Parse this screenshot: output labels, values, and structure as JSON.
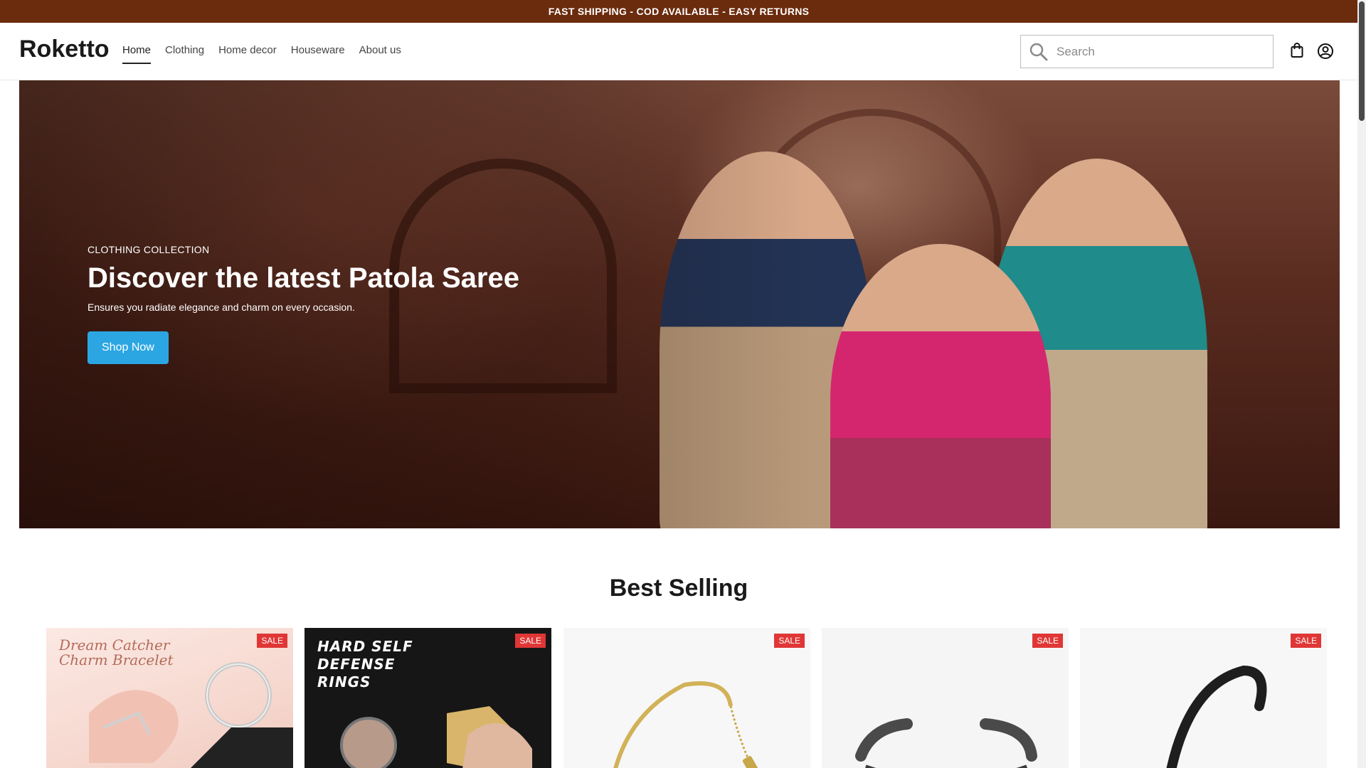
{
  "announcement": "FAST SHIPPING - COD AVAILABLE - EASY RETURNS",
  "header": {
    "logo": "Roketto",
    "nav": [
      "Home",
      "Clothing",
      "Home decor",
      "Houseware",
      "About us"
    ],
    "active_nav": "Home",
    "search": {
      "placeholder": "Search",
      "value": ""
    },
    "icons": [
      "search-icon",
      "bag-icon",
      "account-icon"
    ]
  },
  "hero": {
    "eyebrow": "CLOTHING COLLECTION",
    "title": "Discover the latest Patola Saree",
    "subtitle": "Ensures you radiate elegance and charm on every occasion.",
    "button": "Shop Now"
  },
  "best_selling": {
    "title": "Best Selling",
    "products": [
      {
        "badge": "SALE",
        "image_text": "Dream Catcher Charm Bracelet"
      },
      {
        "badge": "SALE",
        "image_text": "HARD SELF DEFENSE RINGS"
      },
      {
        "badge": "SALE",
        "image_text": ""
      },
      {
        "badge": "SALE",
        "image_text": ""
      },
      {
        "badge": "SALE",
        "image_text": ""
      }
    ]
  },
  "colors": {
    "announcement_bg": "#6b2b0d",
    "button": "#2ba6e3",
    "sale_badge": "#e03636"
  }
}
